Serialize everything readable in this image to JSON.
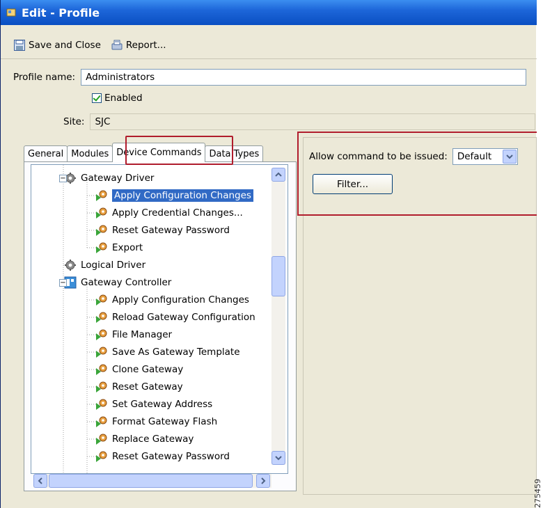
{
  "window": {
    "title": "Edit - Profile"
  },
  "toolbar": {
    "save_close_label": "Save and Close",
    "report_label": "Report..."
  },
  "form": {
    "profile_name_label": "Profile name:",
    "profile_name_value": "Administrators",
    "enabled_label": "Enabled",
    "enabled_checked": true,
    "site_label": "Site:",
    "site_value": "SJC"
  },
  "tabs": [
    {
      "label": "General",
      "active": false
    },
    {
      "label": "Modules",
      "active": false
    },
    {
      "label": "Device Commands",
      "active": true
    },
    {
      "label": "Data Types",
      "active": false
    }
  ],
  "tree": [
    {
      "label": "Gateway Driver",
      "level": 1,
      "icon": "gear-icon",
      "expander": "minus"
    },
    {
      "label": "Apply Configuration Changes",
      "level": 2,
      "icon": "command-icon",
      "selected": true
    },
    {
      "label": "Apply Credential Changes...",
      "level": 2,
      "icon": "command-icon"
    },
    {
      "label": "Reset Gateway Password",
      "level": 2,
      "icon": "command-icon"
    },
    {
      "label": "Export",
      "level": 2,
      "icon": "command-icon"
    },
    {
      "label": "Logical Driver",
      "level": 1,
      "icon": "gear-icon"
    },
    {
      "label": "Gateway Controller",
      "level": 1,
      "icon": "controller-icon",
      "expander": "minus"
    },
    {
      "label": "Apply Configuration Changes",
      "level": 2,
      "icon": "command-icon"
    },
    {
      "label": "Reload Gateway Configuration",
      "level": 2,
      "icon": "command-icon"
    },
    {
      "label": "File Manager",
      "level": 2,
      "icon": "command-icon"
    },
    {
      "label": "Save As Gateway Template",
      "level": 2,
      "icon": "command-icon"
    },
    {
      "label": "Clone Gateway",
      "level": 2,
      "icon": "command-icon"
    },
    {
      "label": "Reset Gateway",
      "level": 2,
      "icon": "command-icon"
    },
    {
      "label": "Set Gateway Address",
      "level": 2,
      "icon": "command-icon"
    },
    {
      "label": "Format Gateway Flash",
      "level": 2,
      "icon": "command-icon"
    },
    {
      "label": "Replace Gateway",
      "level": 2,
      "icon": "command-icon"
    },
    {
      "label": "Reset Gateway Password",
      "level": 2,
      "icon": "command-icon"
    }
  ],
  "permission": {
    "allow_label": "Allow command to be issued:",
    "allow_value": "Default",
    "filter_label": "Filter..."
  },
  "figure_id": "275459",
  "colors": {
    "title_bar": "#1d66d9",
    "selection": "#316ac5",
    "highlight_box": "#b01c2c"
  }
}
